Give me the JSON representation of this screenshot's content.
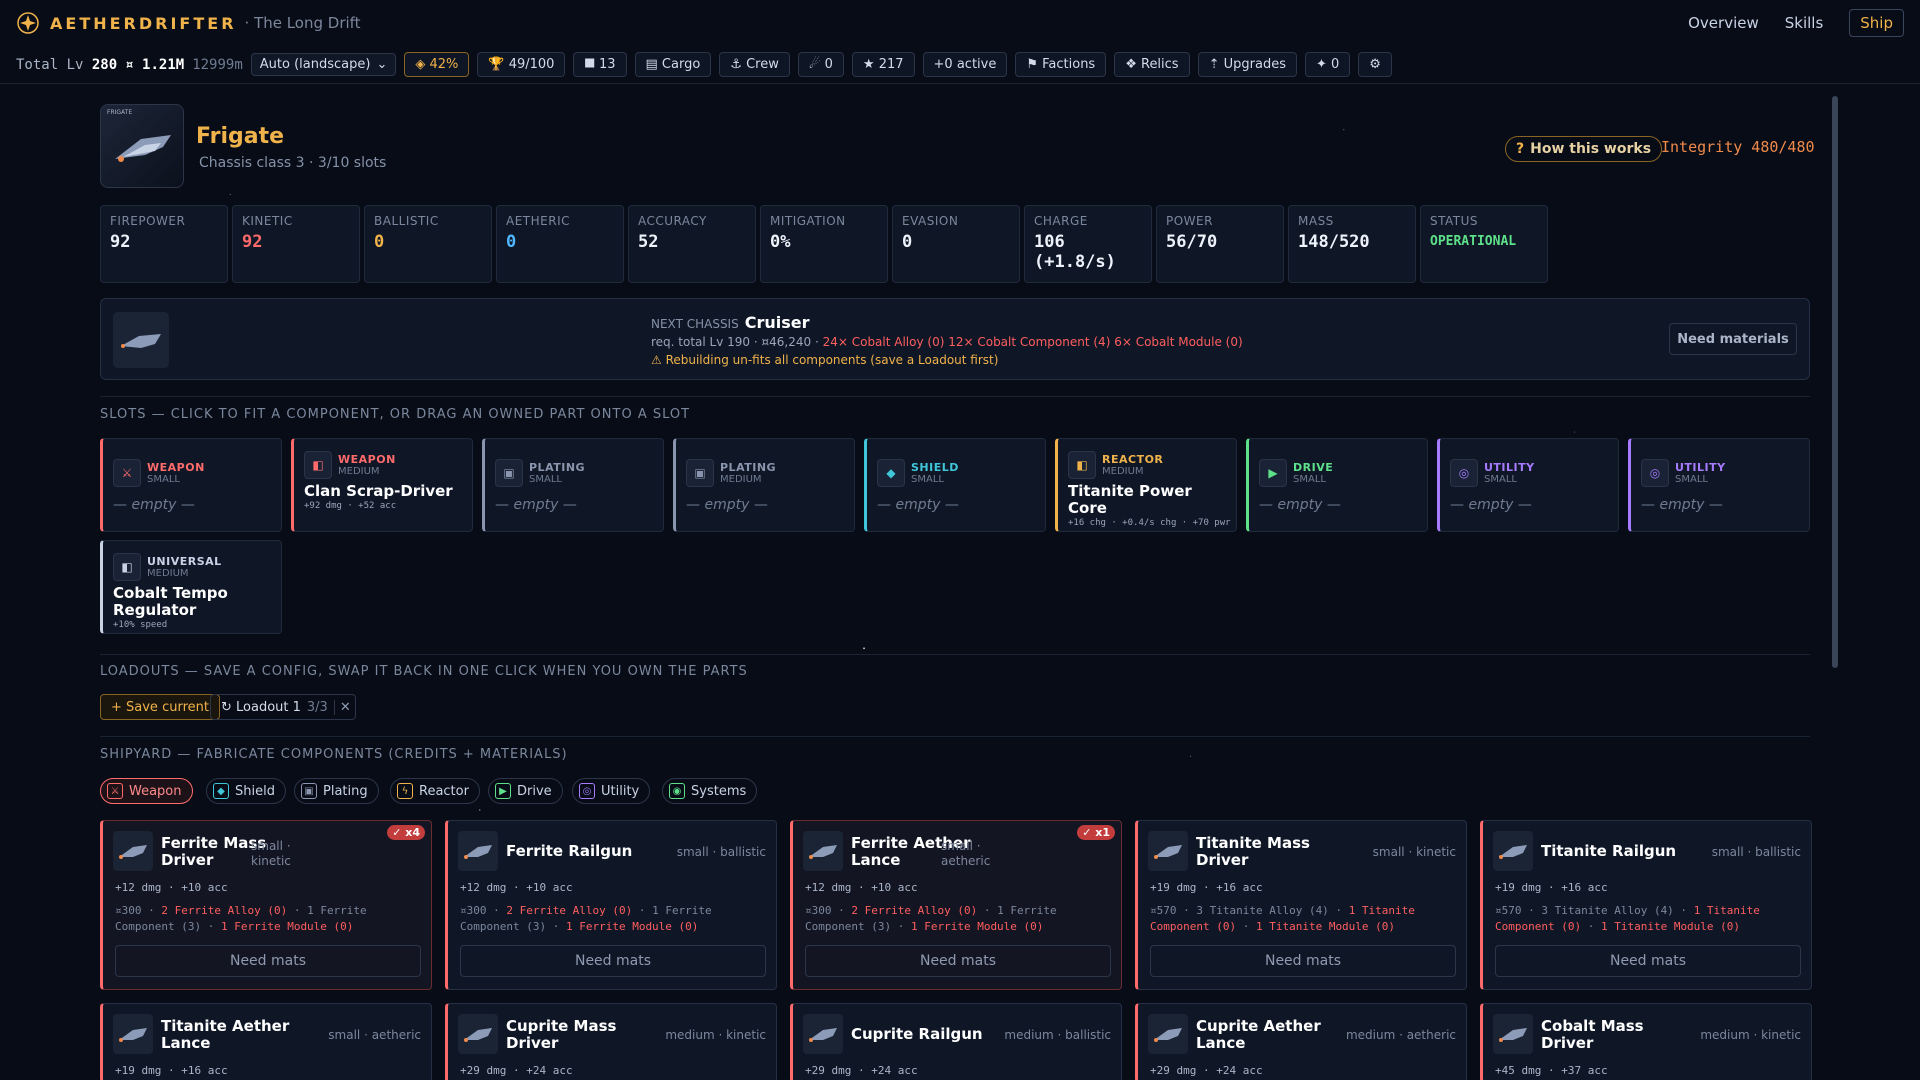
{
  "app": {
    "brand": "AETHERDRIFTER",
    "subtitle": "· The Long Drift"
  },
  "nav": [
    "Overview",
    "Skills",
    "Ship"
  ],
  "status": {
    "total_lv_label": "Total Lv",
    "total_lv": "280",
    "credits": "¤ 1.21M",
    "distance": "12999m",
    "mode": "Auto (landscape)",
    "chips": [
      "◈ 42%",
      "🏆 49/100",
      "⯀ 13",
      "▤ Cargo",
      "⚓ Crew",
      "☄ 0",
      "★ 217",
      "+0 active",
      "⚑ Factions",
      "❖ Relics",
      "⇡ Upgrades",
      "✦ 0",
      "⚙"
    ]
  },
  "ship": {
    "name": "Frigate",
    "sub": "Chassis class 3 · 3/10 slots",
    "how": "How this works",
    "integrity": "Integrity 480/480",
    "thumb_tag": "FRIGATE"
  },
  "stats": [
    {
      "k": "FIREPOWER",
      "v": "92",
      "c": ""
    },
    {
      "k": "KINETIC",
      "v": "92",
      "c": "red"
    },
    {
      "k": "BALLISTIC",
      "v": "0",
      "c": "yellow"
    },
    {
      "k": "AETHERIC",
      "v": "0",
      "c": "blue"
    },
    {
      "k": "ACCURACY",
      "v": "52",
      "c": ""
    },
    {
      "k": "MITIGATION",
      "v": "0%",
      "c": ""
    },
    {
      "k": "EVASION",
      "v": "0",
      "c": ""
    },
    {
      "k": "CHARGE",
      "v": "106 (+1.8/s)",
      "c": ""
    },
    {
      "k": "POWER",
      "v": "56/70",
      "c": ""
    },
    {
      "k": "MASS",
      "v": "148/520",
      "c": ""
    },
    {
      "k": "STATUS",
      "v": "OPERATIONAL",
      "c": "green"
    }
  ],
  "next": {
    "label": "NEXT CHASSIS",
    "name": "Cruiser",
    "req": "req. total Lv 190 · ¤46,240 · ",
    "req_missing": "24× Cobalt Alloy (0) 12× Cobalt Component (4) 6× Cobalt Module (0)",
    "warn": "⚠ Rebuilding un-fits all components (save a Loadout first)",
    "button": "Need materials"
  },
  "sections": {
    "slots": "SLOTS — CLICK TO FIT A COMPONENT, OR DRAG AN OWNED PART ONTO A SLOT",
    "loadouts": "LOADOUTS — SAVE A CONFIG, SWAP IT BACK IN ONE CLICK WHEN YOU OWN THE PARTS",
    "shipyard": "SHIPYARD — FABRICATE COMPONENTS (CREDITS + MATERIALS)"
  },
  "slots": [
    {
      "type": "WEAPON",
      "size": "SMALL",
      "empty": "— empty —",
      "color": "#ff6b6b",
      "icon": "⚔"
    },
    {
      "type": "WEAPON",
      "size": "MEDIUM",
      "name": "Clan Scrap-Driver",
      "desc": "+92 dmg · +52 acc",
      "color": "#ff6b6b"
    },
    {
      "type": "PLATING",
      "size": "SMALL",
      "empty": "— empty —",
      "color": "#8a96ad",
      "icon": "▣"
    },
    {
      "type": "PLATING",
      "size": "MEDIUM",
      "empty": "— empty —",
      "color": "#8a96ad",
      "icon": "▣"
    },
    {
      "type": "SHIELD",
      "size": "SMALL",
      "empty": "— empty —",
      "color": "#3fc6d8",
      "icon": "◆"
    },
    {
      "type": "REACTOR",
      "size": "MEDIUM",
      "name": "Titanite Power Core",
      "desc": "+16 chg · +0.4/s chg · +70 pwr",
      "color": "#f0b24a"
    },
    {
      "type": "DRIVE",
      "size": "SMALL",
      "empty": "— empty —",
      "color": "#5ee08a",
      "icon": "▶"
    },
    {
      "type": "UTILITY",
      "size": "SMALL",
      "empty": "— empty —",
      "color": "#a77bff",
      "icon": "◎"
    },
    {
      "type": "UTILITY",
      "size": "SMALL",
      "empty": "— empty —",
      "color": "#a77bff",
      "icon": "◎"
    },
    {
      "type": "UNIVERSAL",
      "size": "MEDIUM",
      "name": "Cobalt Tempo Regulator",
      "desc": "+10% speed",
      "color": "#c9d3e6"
    }
  ],
  "loadouts": {
    "save": "+ Save current",
    "loadout": "↻ Loadout 1",
    "count": "3/3",
    "close": "✕"
  },
  "tabs": [
    {
      "label": "Weapon",
      "icon": "⚔",
      "color": "#ff6b6b"
    },
    {
      "label": "Shield",
      "icon": "◆",
      "color": "#3fc6d8"
    },
    {
      "label": "Plating",
      "icon": "▣",
      "color": "#8a96ad"
    },
    {
      "label": "Reactor",
      "icon": "ϟ",
      "color": "#f0b24a"
    },
    {
      "label": "Drive",
      "icon": "▶",
      "color": "#5ee08a"
    },
    {
      "label": "Utility",
      "icon": "◎",
      "color": "#a77bff"
    },
    {
      "label": "Systems",
      "icon": "◉",
      "color": "#5ee08a"
    }
  ],
  "components": [
    {
      "name": "Ferrite Mass Driver",
      "tag": "small · kinetic",
      "badge": "✓ x4",
      "hl": true,
      "stat": "+12 dmg · +10 acc",
      "cost_a": "¤300 · ",
      "cost_b": "2 Ferrite Alloy (0)",
      "cost_c": " · 1 Ferrite Component (3) · ",
      "cost_d": "1 Ferrite Module (0)",
      "btn": "Need mats"
    },
    {
      "name": "Ferrite Railgun",
      "tag": "small · ballistic",
      "badge": "",
      "hl": false,
      "stat": "+12 dmg · +10 acc",
      "cost_a": "¤300 · ",
      "cost_b": "2 Ferrite Alloy (0)",
      "cost_c": " · 1 Ferrite Component (3) · ",
      "cost_d": "1 Ferrite Module (0)",
      "btn": "Need mats"
    },
    {
      "name": "Ferrite Aether Lance",
      "tag": "small · aetheric",
      "badge": "✓ x1",
      "hl": true,
      "stat": "+12 dmg · +10 acc",
      "cost_a": "¤300 · ",
      "cost_b": "2 Ferrite Alloy (0)",
      "cost_c": " · 1 Ferrite Component (3) · ",
      "cost_d": "1 Ferrite Module (0)",
      "btn": "Need mats"
    },
    {
      "name": "Titanite Mass Driver",
      "tag": "small · kinetic",
      "badge": "",
      "hl": false,
      "stat": "+19 dmg · +16 acc",
      "cost_a": "¤570 · 3 Titanite Alloy (4) · ",
      "cost_b": "1 Titanite Component (0)",
      "cost_c": " · ",
      "cost_d": "1 Titanite Module (0)",
      "btn": "Need mats"
    },
    {
      "name": "Titanite Railgun",
      "tag": "small · ballistic",
      "badge": "",
      "hl": false,
      "stat": "+19 dmg · +16 acc",
      "cost_a": "¤570 · 3 Titanite Alloy (4) · ",
      "cost_b": "1 Titanite Component (0)",
      "cost_c": " · ",
      "cost_d": "1 Titanite Module (0)",
      "btn": "Need mats"
    },
    {
      "name": "Titanite Aether Lance",
      "tag": "small · aetheric",
      "stat": "+19 dmg · +16 acc"
    },
    {
      "name": "Cuprite Mass Driver",
      "tag": "medium · kinetic",
      "stat": "+29 dmg · +24 acc"
    },
    {
      "name": "Cuprite Railgun",
      "tag": "medium · ballistic",
      "stat": "+29 dmg · +24 acc"
    },
    {
      "name": "Cuprite Aether Lance",
      "tag": "medium · aetheric",
      "stat": "+29 dmg · +24 acc"
    },
    {
      "name": "Cobalt Mass Driver",
      "tag": "medium · kinetic",
      "stat": "+45 dmg · +37 acc"
    }
  ],
  "colors": {
    "accent": "#f0b24a",
    "danger": "#ff6b6b",
    "bg": "#070c17"
  }
}
